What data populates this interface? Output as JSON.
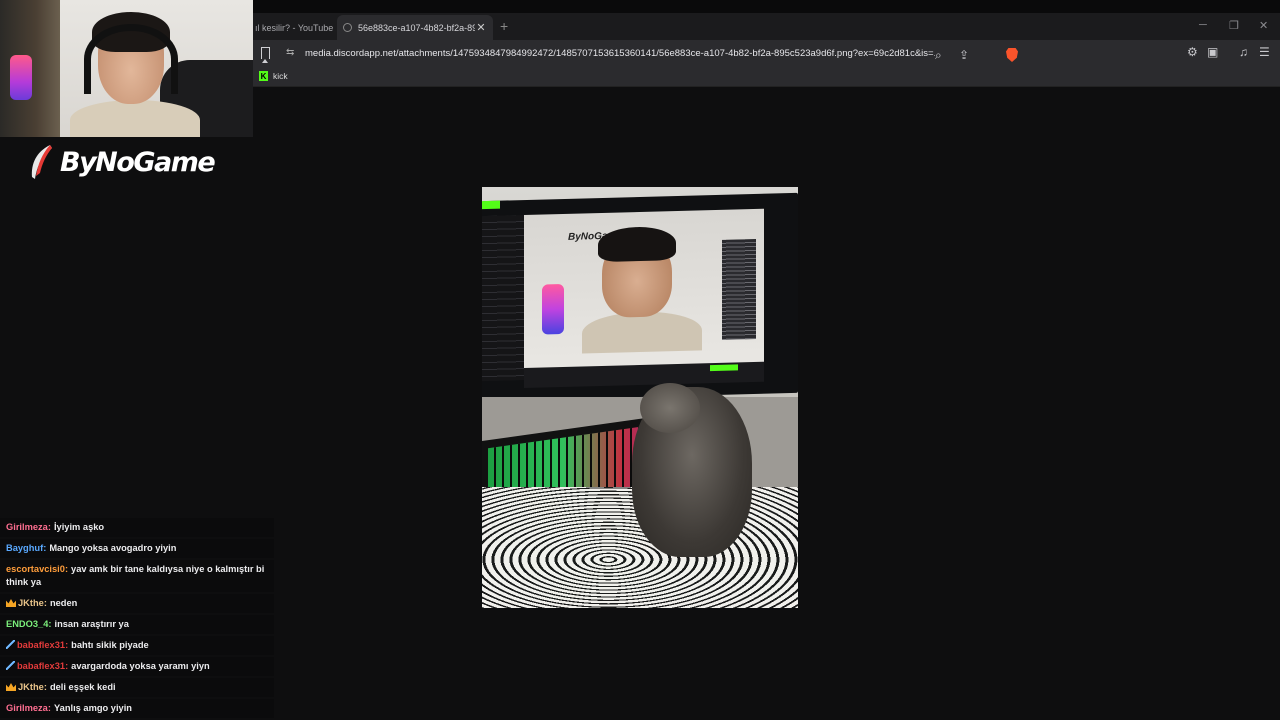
{
  "browser": {
    "tabs": [
      {
        "title": "ıl kesilir? - YouTube",
        "active": false
      },
      {
        "title": "56e883ce-a107-4b82-bf2a-895c",
        "active": true
      }
    ],
    "new_tab_label": "+",
    "window_controls": {
      "minimize": "─",
      "restore": "❐",
      "close": "✕"
    },
    "address_bar": {
      "url": "media.discordapp.net/attachments/1475934847984992472/1485707153615360141/56e883ce-a107-4b82-bf2a-895c523a9d6f.png?ex=69c2d81c&is=..."
    },
    "bookmarks": [
      {
        "label": "kick"
      }
    ],
    "accent_colors": {
      "brave": "#fb542b",
      "kick": "#53fc18"
    }
  },
  "overlay": {
    "logo_text": "ByNoGame"
  },
  "viewer": {
    "image_alt": "Photo of monitor showing stream with a kitten on a gaming keyboard",
    "mini_logo": "ByNoGame"
  },
  "chat": {
    "messages": [
      {
        "badge": "",
        "user": "Girilmeza",
        "color": "#ff6f91",
        "text": "İyiyim aşko"
      },
      {
        "badge": "",
        "user": "Bayghuf",
        "color": "#5aa9ff",
        "text": "Mango yoksa avogadro yiyin"
      },
      {
        "badge": "",
        "user": "escortavcisi0",
        "color": "#ff9d3b",
        "text": "yav amk bir tane kaldıysa niye o kalmıştır bi think ya"
      },
      {
        "badge": "crown",
        "user": "JKthe",
        "color": "#e9c48a",
        "text": "neden"
      },
      {
        "badge": "",
        "user": "ENDO3_4",
        "color": "#7cf07c",
        "text": "insan araştırır ya"
      },
      {
        "badge": "sword",
        "user": "babaflex31",
        "color": "#e23b3b",
        "text": "bahtı sikik piyade"
      },
      {
        "badge": "sword",
        "user": "babaflex31",
        "color": "#e23b3b",
        "text": "avargardoda yoksa yaramı yiyn"
      },
      {
        "badge": "crown",
        "user": "JKthe",
        "color": "#e9c48a",
        "text": "deli eşşek kedi"
      },
      {
        "badge": "",
        "user": "Girilmeza",
        "color": "#ff6f91",
        "text": "Yanlış amgo yiyin"
      }
    ]
  }
}
